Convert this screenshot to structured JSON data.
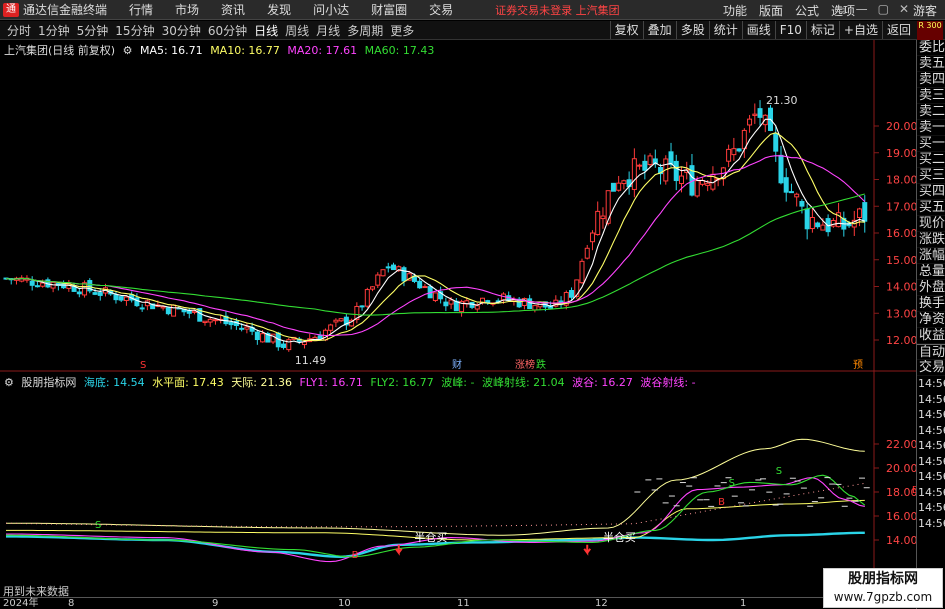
{
  "app": {
    "logo": "通",
    "title": "通达信金融终端"
  },
  "menu": [
    "行情",
    "市场",
    "资讯",
    "发现",
    "问小达",
    "财富圈",
    "交易"
  ],
  "notice": "证券交易未登录  上汽集团",
  "right_menu": [
    "功能",
    "版面",
    "公式",
    "选项"
  ],
  "window_controls": [
    "▭",
    "—",
    "▢",
    "✕"
  ],
  "guest": "游客",
  "periods": [
    "分时",
    "1分钟",
    "5分钟",
    "15分钟",
    "30分钟",
    "60分钟",
    "日线",
    "周线",
    "月线",
    "多周期",
    "更多"
  ],
  "tools": [
    "复权",
    "叠加",
    "多股",
    "统计",
    "画线",
    "F10",
    "标记",
    "+自选",
    "返回"
  ],
  "rbadge": "R 300",
  "main_header": {
    "title": "上汽集团(日线 前复权)",
    "ma5": "MA5: 16.71",
    "ma10": "MA10: 16.77",
    "ma20": "MA20: 17.61",
    "ma60": "MA60: 17.43"
  },
  "main_axis": [
    "20.00",
    "19.00",
    "18.00",
    "17.00",
    "16.00",
    "15.00",
    "14.00",
    "13.00",
    "12.00"
  ],
  "annotations": {
    "high": "21.30",
    "low": "11.49"
  },
  "markers": [
    {
      "text": "S",
      "color": "#ff3333"
    },
    {
      "text": "财",
      "color": "#7fb3ff"
    },
    {
      "text": "涨榜",
      "color": "#ff6666"
    },
    {
      "text": "跌",
      "color": "#33dd33"
    },
    {
      "text": "预",
      "color": "#ff8800"
    }
  ],
  "ind_header": {
    "name": "股朋指标网",
    "haidi": "海底: 14.54",
    "shuiping": "水平面: 17.43",
    "tianji": "天际: 21.36",
    "fly1": "FLY1: 16.71",
    "fly2": "FLY2: 16.77",
    "bofeng": "波峰: -",
    "bofeng_line": "波峰射线: 21.04",
    "bogu": "波谷: 16.27",
    "bogu_line": "波谷射线: -"
  },
  "ind_axis": [
    "22.00",
    "20.00",
    "18.00",
    "16.00",
    "14.00"
  ],
  "ind_labels": {
    "half_buy1": "半仓买",
    "half_buy2": "半仓买",
    "s": "S",
    "b": "B"
  },
  "side_panel": [
    "委比",
    "卖五",
    "卖四",
    "卖三",
    "卖二",
    "卖一",
    "买一",
    "买二",
    "买三",
    "买四",
    "买五",
    "现价",
    "涨跌",
    "涨幅",
    "总量",
    "外盘",
    "换手",
    "净资",
    "收益"
  ],
  "side_panel2": [
    "自动",
    "交易"
  ],
  "side_times": [
    "14:56",
    "14:56",
    "14:56",
    "14:56",
    "14:56",
    "14:56",
    "14:56",
    "14:56",
    "14:56",
    "14:56"
  ],
  "future_note": "用到未来数据",
  "dates": [
    {
      "label": "2024年"
    },
    {
      "label": "8"
    },
    {
      "label": "9"
    },
    {
      "label": "10"
    },
    {
      "label": "11"
    },
    {
      "label": "12"
    },
    {
      "label": "1"
    }
  ],
  "watermark": {
    "line1": "股朋指标网",
    "line2": "www.7gpzb.com"
  },
  "colors": {
    "up": "#ff3b3b",
    "down": "#2ad4e8",
    "ma5": "#ffffff",
    "ma10": "#ffff66",
    "ma20": "#ff44ff",
    "ma60": "#33dd33"
  }
}
